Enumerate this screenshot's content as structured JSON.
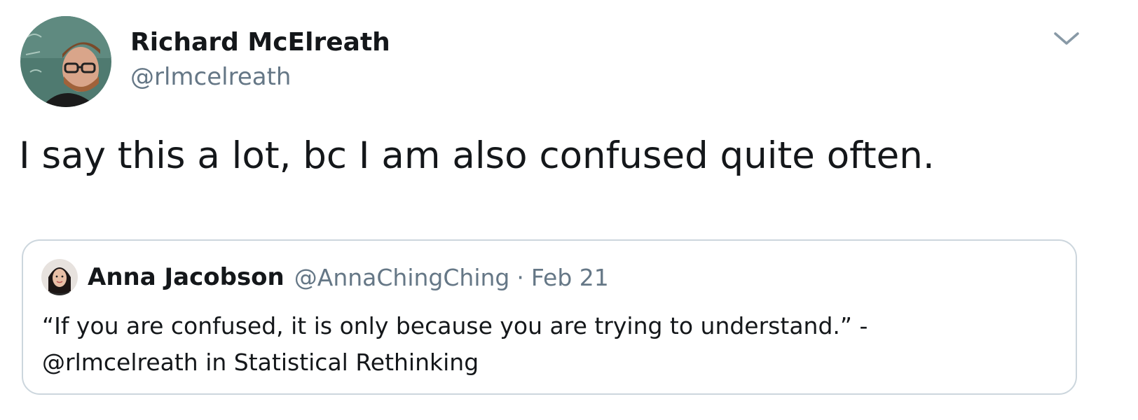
{
  "tweet": {
    "author": {
      "display_name": "Richard McElreath",
      "handle": "@rlmcelreath",
      "avatar_icon": "profile-photo"
    },
    "menu_icon": "chevron-down-icon",
    "text": "I say this a lot, bc I am also confused quite often.",
    "quoted_tweet": {
      "author": {
        "display_name": "Anna Jacobson",
        "handle": "@AnnaChingChing",
        "avatar_icon": "profile-photo"
      },
      "separator": "·",
      "date": "Feb 21",
      "text_lines": [
        "“If you are confused, it is only because you are trying to understand.” -",
        "@rlmcelreath in Statistical Rethinking"
      ]
    }
  },
  "colors": {
    "text_primary": "#14171a",
    "text_secondary": "#657786",
    "border": "#ccd6dd",
    "background": "#ffffff"
  }
}
